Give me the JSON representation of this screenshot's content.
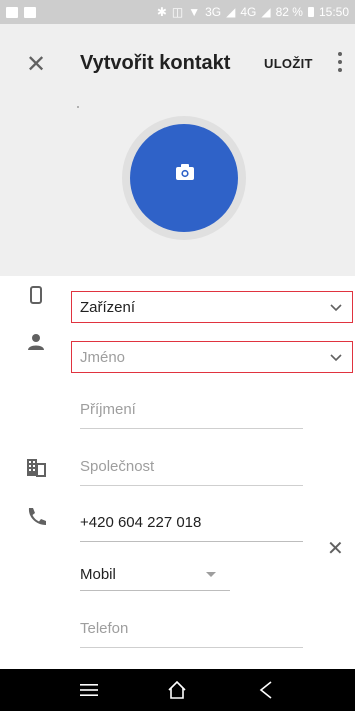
{
  "status_bar": {
    "network_text": "3G",
    "network_text2": "4G",
    "battery_text": "82 %",
    "time": "15:50"
  },
  "toolbar": {
    "close_icon": "close-icon",
    "title": "Vytvořit kontakt",
    "save_label": "ULOŽIT",
    "more_icon": "more-vert-icon"
  },
  "avatar": {
    "icon": "camera-icon",
    "color": "#2f62c8"
  },
  "form": {
    "account": {
      "value": "Zařízení",
      "icon": "phone-device-icon"
    },
    "first_name": {
      "placeholder": "Jméno",
      "icon": "person-icon"
    },
    "last_name": {
      "placeholder": "Příjmení"
    },
    "company": {
      "placeholder": "Společnost",
      "icon": "business-icon"
    },
    "phone": {
      "value": "+420 604 227 018",
      "icon": "phone-icon",
      "type": "Mobil"
    },
    "phone2": {
      "placeholder": "Telefon"
    }
  },
  "colors": {
    "highlight_box": "#e0333f",
    "header_bg": "#efefef"
  },
  "nav": {
    "menu_icon": "menu-icon",
    "home_icon": "home-icon",
    "back_icon": "back-icon"
  }
}
